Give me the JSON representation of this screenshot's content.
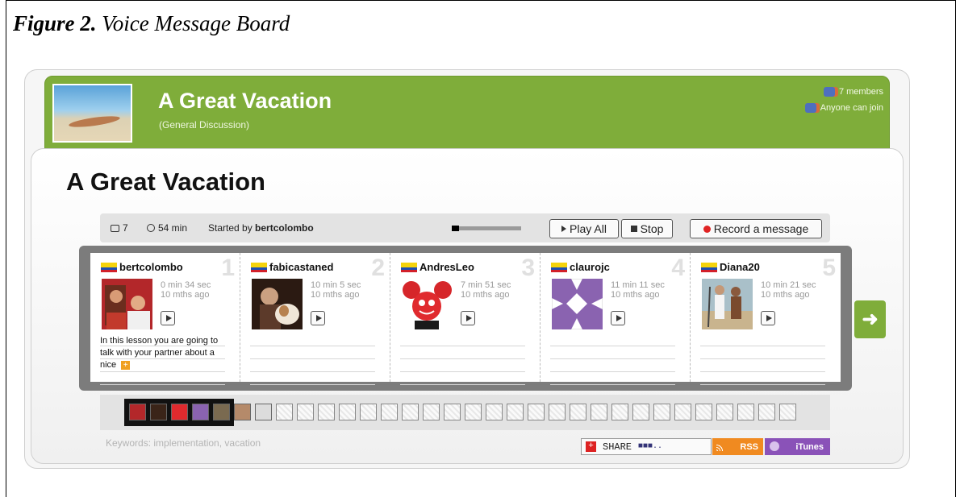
{
  "figure": {
    "label": "Figure 2.",
    "title": "Voice Message Board"
  },
  "group": {
    "title": "A Great Vacation",
    "subtitle": "(General Discussion)",
    "members": "7 members",
    "join": "Anyone can join"
  },
  "board": {
    "title": "A Great Vacation",
    "comment_count": "7",
    "duration": "54 min",
    "started_by_label": "Started by",
    "started_by": "bertcolombo",
    "progress_fraction": 0.1,
    "play_all": "Play All",
    "stop": "Stop",
    "record": "Record a message"
  },
  "messages": [
    {
      "user": "bertcolombo",
      "num": "1",
      "length": "0 min 34 sec",
      "age": "10 mths ago",
      "text": "In this lesson you are going to talk with your partner about a nice"
    },
    {
      "user": "fabicastaned",
      "num": "2",
      "length": "10 min 5 sec",
      "age": "10 mths ago",
      "text": ""
    },
    {
      "user": "AndresLeo",
      "num": "3",
      "length": "7 min 51 sec",
      "age": "10 mths ago",
      "text": ""
    },
    {
      "user": "claurojc",
      "num": "4",
      "length": "11 min 11 sec",
      "age": "10 mths ago",
      "text": ""
    },
    {
      "user": "Diana20",
      "num": "5",
      "length": "10 min 21 sec",
      "age": "10 mths ago",
      "text": ""
    }
  ],
  "footer": {
    "keywords": "Keywords: implementation, vacation",
    "share": "SHARE",
    "rss": "RSS",
    "itunes": "iTunes"
  },
  "colors": {
    "accent_green": "#7fad3a",
    "record_red": "#e02424",
    "rss_orange": "#f08a20",
    "itunes_purple": "#8a52b8"
  }
}
